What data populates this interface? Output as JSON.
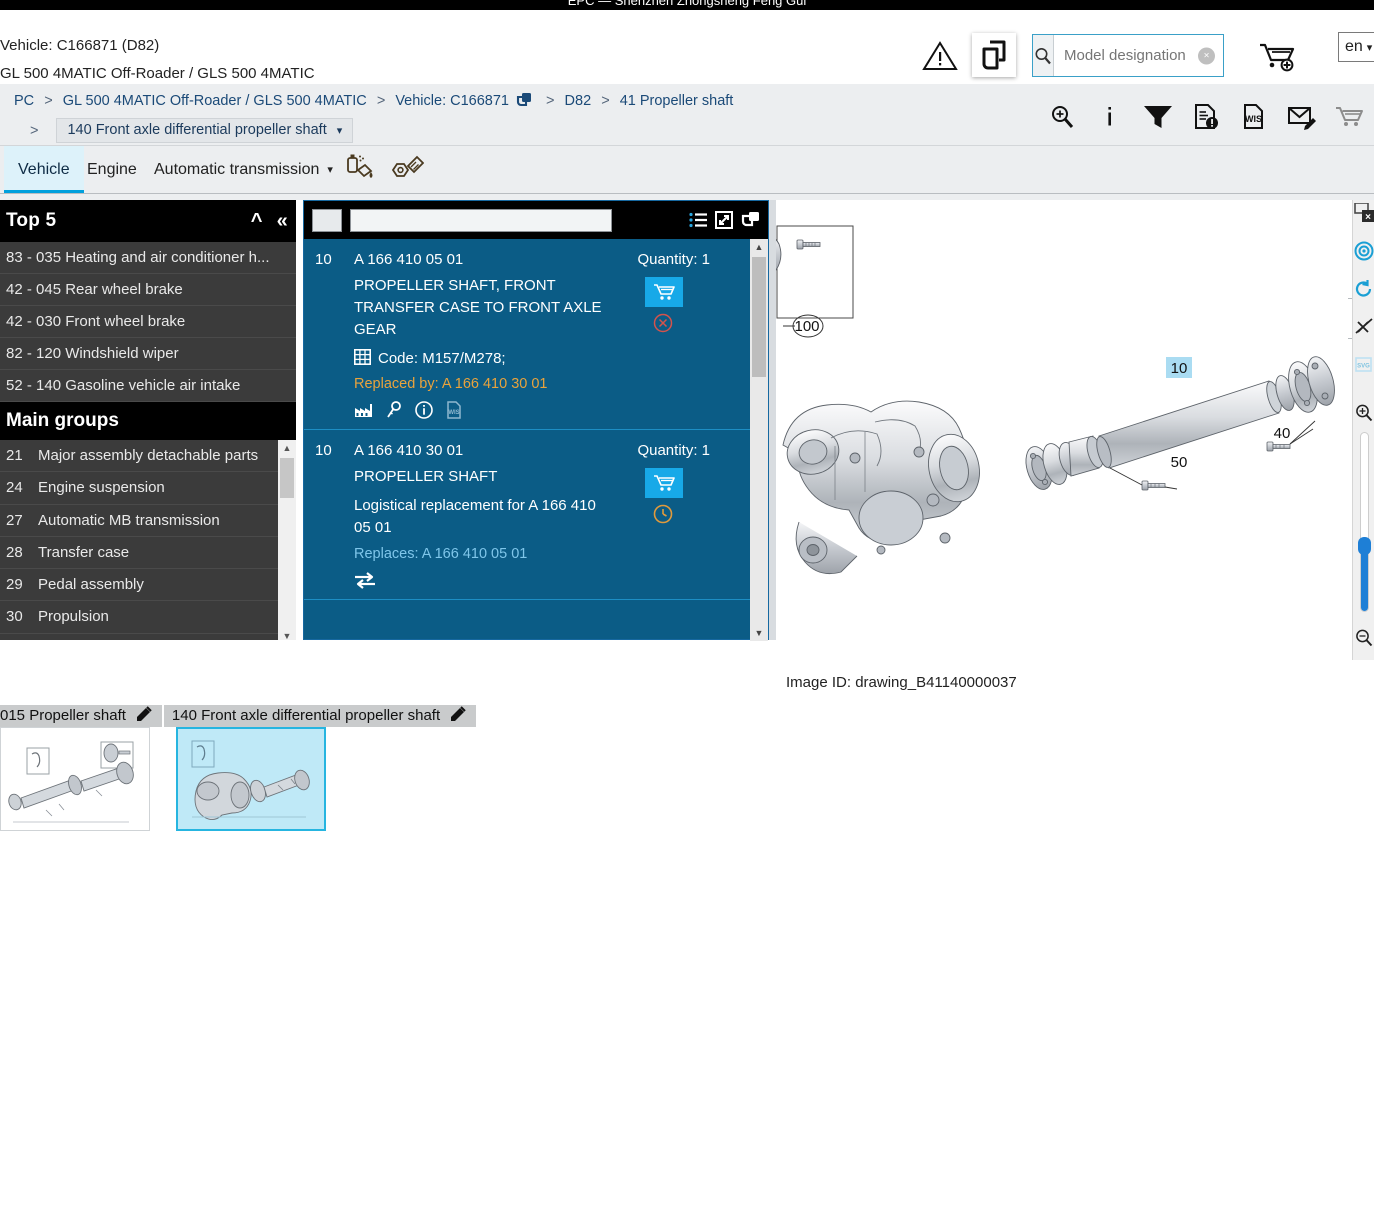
{
  "topbar": {
    "text": "EPC — Shenzhen Zhongsheng Feng Gui"
  },
  "header": {
    "vehicle_line": "Vehicle: C166871 (D82)",
    "model_line": "GL 500 4MATIC Off-Roader / GLS 500 4MATIC",
    "warning_icon": "warning-triangle-icon",
    "copy_icon": "copy-documents-icon",
    "model_search": {
      "placeholder": "Model designation",
      "value": "",
      "icon": "search-icon",
      "clear": "×"
    },
    "cart_icon": "add-to-cart-icon",
    "language": "en"
  },
  "breadcrumb": {
    "items": [
      "PC",
      "GL 500 4MATIC Off-Roader / GLS 500 4MATIC",
      "Vehicle: C166871",
      "D82",
      "41 Propeller shaft"
    ],
    "separator": ">",
    "duplicate_icon": "duplicate-icon",
    "current": "140 Front axle differential propeller shaft",
    "current_caret": "▾"
  },
  "toolbar": {
    "buttons": [
      {
        "name": "zoom-search-icon",
        "label": "Zoom search"
      },
      {
        "name": "info-icon",
        "label": "Information"
      },
      {
        "name": "filter-icon",
        "label": "Filter"
      },
      {
        "name": "document-alert-icon",
        "label": "Document notes"
      },
      {
        "name": "wis-document-icon",
        "label": "WIS"
      },
      {
        "name": "mail-edit-icon",
        "label": "Mail"
      },
      {
        "name": "cart-icon",
        "label": "Cart"
      }
    ]
  },
  "tabs": {
    "items": [
      {
        "label": "Vehicle",
        "active": true
      },
      {
        "label": "Engine",
        "active": false
      },
      {
        "label": "Automatic transmission",
        "active": false,
        "caret": "▾"
      }
    ],
    "icons": [
      {
        "name": "paint-spray-icon"
      },
      {
        "name": "bolt-nut-icon"
      }
    ],
    "search": {
      "placeholder": "",
      "value": "",
      "icon": "search-icon",
      "clear": "×"
    }
  },
  "sidebar": {
    "top5": {
      "title": "Top 5",
      "collapse_icon": "chevron-up-icon",
      "collapse_all_icon": "double-chevron-left-icon",
      "items": [
        "83 - 035 Heating and air conditioner h...",
        "42 - 045 Rear wheel brake",
        "42 - 030 Front wheel brake",
        "82 - 120 Windshield wiper",
        "52 - 140 Gasoline vehicle air intake"
      ]
    },
    "main_groups": {
      "title": "Main groups",
      "items": [
        {
          "num": "21",
          "label": "Major assembly detachable parts"
        },
        {
          "num": "24",
          "label": "Engine suspension"
        },
        {
          "num": "27",
          "label": "Automatic MB transmission"
        },
        {
          "num": "28",
          "label": "Transfer case"
        },
        {
          "num": "29",
          "label": "Pedal assembly"
        },
        {
          "num": "30",
          "label": "Propulsion"
        }
      ],
      "scroll_up": "▲",
      "scroll_down": "▼"
    }
  },
  "parts_panel": {
    "filter_small": "",
    "filter_large": "",
    "head_icons": [
      {
        "name": "list-view-icon"
      },
      {
        "name": "expand-icon"
      },
      {
        "name": "duplicate-window-icon"
      }
    ],
    "scroll_up": "▲",
    "scroll_down": "▼",
    "items": [
      {
        "pos": "10",
        "part_number": "A 166 410 05 01",
        "description": "PROPELLER SHAFT, FRONT TRANSFER CASE TO FRONT AXLE GEAR",
        "code_label": "Code: M157/M278;",
        "code_icon": "table-grid-icon",
        "replaced_by": "Replaced by: A 166 410 30 01",
        "quantity_label": "Quantity: 1",
        "cart_icon": "cart-icon",
        "status_icon": "red-cancel-icon",
        "icons": [
          {
            "name": "factory-icon"
          },
          {
            "name": "key-icon"
          },
          {
            "name": "info-circle-icon"
          },
          {
            "name": "wis-icon"
          }
        ]
      },
      {
        "pos": "10",
        "part_number": "A 166 410 30 01",
        "description": "PROPELLER SHAFT",
        "note": "Logistical replacement for A 166 410 05 01",
        "replaces": "Replaces: A 166 410 05 01",
        "quantity_label": "Quantity: 1",
        "cart_icon": "cart-icon",
        "status_icon": "orange-clock-icon",
        "icons": [
          {
            "name": "exchange-arrows-icon"
          }
        ]
      }
    ]
  },
  "drawing": {
    "image_id": "Image ID: drawing_B41140000037",
    "callouts": [
      {
        "label": "100"
      },
      {
        "label": "10",
        "highlighted": true
      },
      {
        "label": "40"
      },
      {
        "label": "50"
      }
    ],
    "viewer_tools": [
      {
        "name": "close-view-icon"
      },
      {
        "name": "target-focus-icon"
      },
      {
        "name": "rotate-reset-icon"
      },
      {
        "name": "hide-crosshair-icon"
      },
      {
        "name": "svg-export-icon"
      },
      {
        "name": "zoom-in-icon"
      },
      {
        "name": "zoom-out-icon"
      }
    ],
    "zoom_slider_value": 34
  },
  "thumbnail_tabs": [
    {
      "label": "015 Propeller shaft",
      "edit_icon": "edit-icon",
      "selected": false
    },
    {
      "label": "140 Front axle differential propeller shaft",
      "edit_icon": "edit-icon",
      "selected": true
    }
  ],
  "colors": {
    "accent_blue": "#00a0dd",
    "panel_blue": "#0b5c86",
    "orange": "#e8a33d",
    "link_blue": "#7fc6ea",
    "thumb_selected": "#bfe9f7"
  }
}
